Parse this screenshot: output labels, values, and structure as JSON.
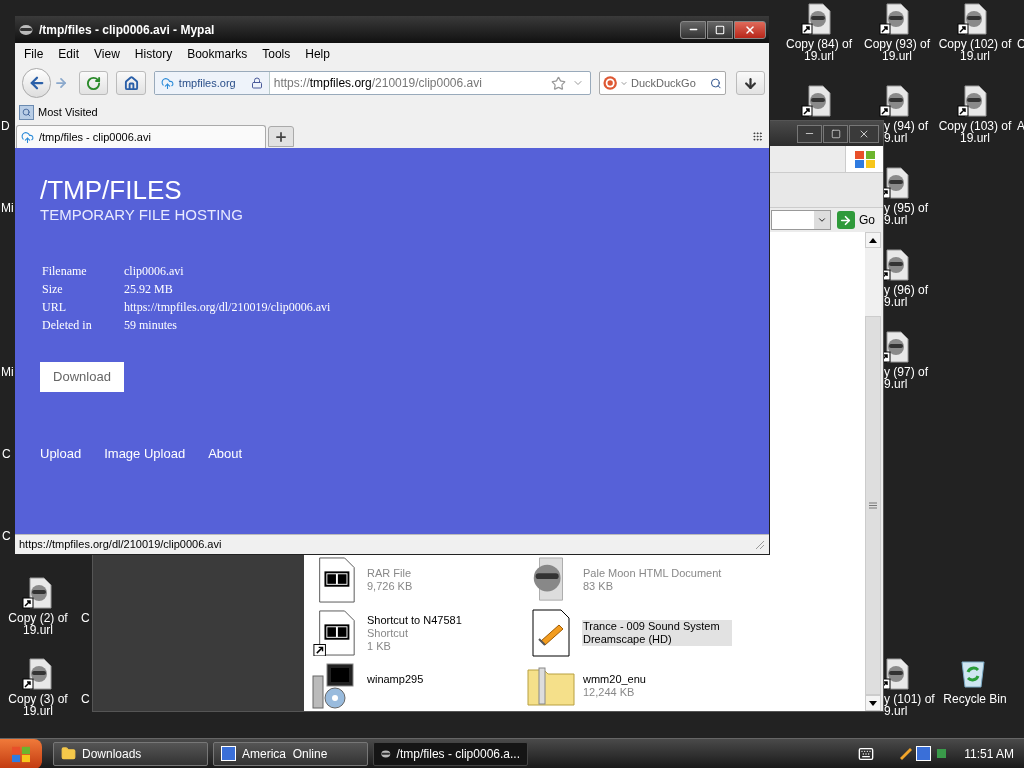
{
  "desktop": {
    "icons": [
      {
        "kind": "url",
        "lines": [
          "Copy (84) of",
          "19.url"
        ]
      },
      {
        "kind": "url",
        "lines": [
          "Copy (93) of",
          "19.url"
        ]
      },
      {
        "kind": "url",
        "lines": [
          "Copy (102) of",
          "19.url"
        ]
      },
      {
        "kind": "fragment",
        "lines": [
          "C"
        ]
      },
      {
        "kind": "url"
      },
      {
        "kind": "url",
        "lines": [
          "y (94) of",
          "9.url"
        ]
      },
      {
        "kind": "url",
        "lines": [
          "Copy (103) of",
          "19.url"
        ]
      },
      {
        "kind": "fragment",
        "lines": [
          "A"
        ]
      },
      {
        "kind": "url",
        "lines": [
          "y (95) of",
          "9.url"
        ]
      },
      {
        "kind": "url",
        "lines": [
          "y (96) of",
          "9.url"
        ]
      },
      {
        "kind": "url",
        "lines": [
          "y (97) of",
          "9.url"
        ]
      },
      {
        "kind": "fragment",
        "lines": [
          "D"
        ]
      },
      {
        "kind": "fragment",
        "lines": [
          "Mi"
        ]
      },
      {
        "kind": "fragment",
        "lines": [
          "Mi"
        ]
      },
      {
        "kind": "fragment",
        "lines": [
          "C"
        ]
      },
      {
        "kind": "fragment",
        "lines": [
          "C"
        ]
      },
      {
        "kind": "url",
        "lines": [
          "Copy (2) of",
          "19.url"
        ]
      },
      {
        "kind": "fragment",
        "lines": [
          "C"
        ]
      },
      {
        "kind": "url",
        "lines": [
          "Copy (3) of",
          "19.url"
        ]
      },
      {
        "kind": "fragment",
        "lines": [
          "C"
        ]
      },
      {
        "kind": "url",
        "lines": [
          "y (101) of",
          "9.url"
        ]
      },
      {
        "kind": "recycle",
        "lines": [
          "Recycle Bin"
        ]
      }
    ]
  },
  "explorer": {
    "go_button": "Go",
    "files": [
      {
        "kind": "archive",
        "type": "RAR File",
        "size": "9,726 KB",
        "selected": false
      },
      {
        "kind": "browser-doc",
        "type": "Pale Moon HTML Document",
        "size": "83 KB",
        "selected": false
      },
      {
        "kind": "archive-shortcut",
        "name": "Shortcut to N47581",
        "type": "Shortcut",
        "size": "1 KB",
        "selected": false
      },
      {
        "kind": "media",
        "name": "Trance - 009 Sound System Dreamscape (HD)",
        "selected": true
      },
      {
        "kind": "installer",
        "name": "winamp295",
        "selected": false
      },
      {
        "kind": "zip-folder",
        "name": "wmm20_enu",
        "size": "12,244 KB",
        "selected": false
      }
    ]
  },
  "browser": {
    "title": "/tmp/files - clip0006.avi - Mypal",
    "menu": [
      "File",
      "Edit",
      "View",
      "History",
      "Bookmarks",
      "Tools",
      "Help"
    ],
    "address": {
      "site": "tmpfiles.org",
      "scheme": "https://",
      "host": "tmpfiles.org",
      "path": "/210019/clip0006.avi"
    },
    "search": {
      "placeholder": "DuckDuckGo"
    },
    "bookmarks": [
      "Most Visited"
    ],
    "tabs": [
      {
        "label": "/tmp/files - clip0006.avi",
        "selected": true
      }
    ],
    "page": {
      "title": "/TMP/FILES",
      "subtitle": "TEMPORARY FILE HOSTING",
      "fields": [
        {
          "label": "Filename",
          "value": "clip0006.avi"
        },
        {
          "label": "Size",
          "value": "25.92 MB"
        },
        {
          "label": "URL",
          "value": "https://tmpfiles.org/dl/210019/clip0006.avi"
        },
        {
          "label": "Deleted in",
          "value": "59 minutes"
        }
      ],
      "download_button": "Download",
      "footer_links": [
        "Upload",
        "Image Upload",
        "About"
      ]
    },
    "status": "https://tmpfiles.org/dl/210019/clip0006.avi"
  },
  "taskbar": {
    "tasks": [
      {
        "kind": "folder",
        "label": "Downloads",
        "selected": false
      },
      {
        "kind": "app",
        "label": "America  Online",
        "selected": false
      },
      {
        "kind": "browser",
        "label": "/tmp/files - clip0006.a...",
        "selected": true
      }
    ],
    "clock": "11:51 AM"
  }
}
